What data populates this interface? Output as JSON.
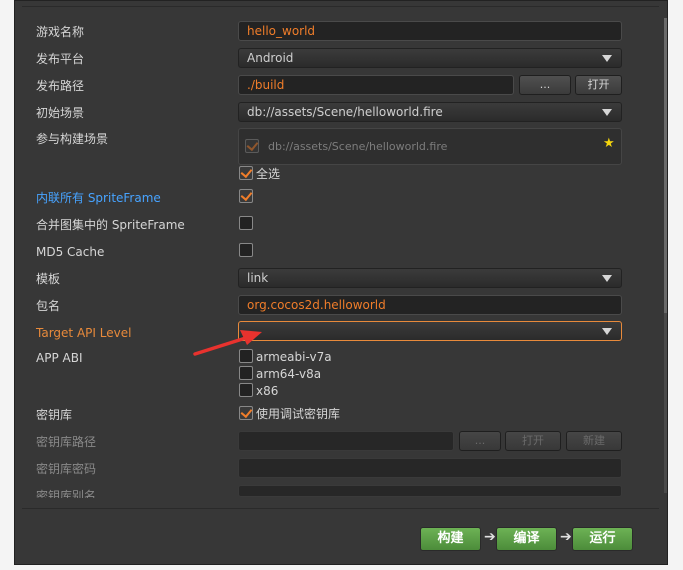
{
  "labels": {
    "game_name": "游戏名称",
    "platform": "发布平台",
    "build_path": "发布路径",
    "start_scene": "初始场景",
    "build_scenes": "参与构建场景",
    "inline_sprite": "内联所有 SpriteFrame",
    "merge_atlas": "合并图集中的 SpriteFrame",
    "md5": "MD5 Cache",
    "template": "模板",
    "package": "包名",
    "target_api": "Target API Level",
    "app_abi": "APP ABI",
    "keystore": "密钥库",
    "keystore_path": "密钥库路径",
    "keystore_password": "密钥库密码",
    "keystore_alias": "密钥库别名"
  },
  "values": {
    "game_name": "hello_world",
    "platform": "Android",
    "build_path": "./build",
    "start_scene": "db://assets/Scene/helloworld.fire",
    "scene_item": "db://assets/Scene/helloworld.fire",
    "select_all": "全选",
    "template": "link",
    "package": "org.cocos2d.helloworld",
    "target_api": "",
    "abi_1": "armeabi-v7a",
    "abi_2": "arm64-v8a",
    "abi_3": "x86",
    "use_debug_keystore": "使用调试密钥库"
  },
  "buttons": {
    "browse": "...",
    "open": "打开",
    "ks_browse": "...",
    "ks_open": "打开",
    "ks_new": "新建",
    "build": "构建",
    "compile": "编译",
    "run": "运行"
  },
  "icons": {
    "star": "star-icon",
    "caret": "chevron-down-icon"
  },
  "colors": {
    "accent_orange": "#f07d2a",
    "link_blue": "#47a3ff",
    "action_green": "#5ca046"
  }
}
